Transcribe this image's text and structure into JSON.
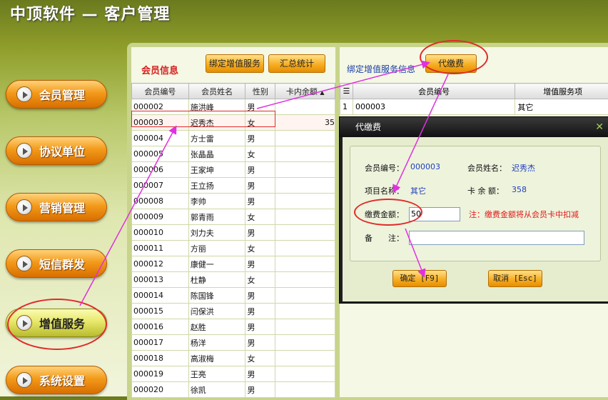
{
  "app": {
    "title": "中顶软件 — 客户管理"
  },
  "nav": [
    {
      "label": "会员管理"
    },
    {
      "label": "协议单位"
    },
    {
      "label": "营销管理"
    },
    {
      "label": "短信群发"
    },
    {
      "label": "增值服务"
    },
    {
      "label": "系统设置"
    }
  ],
  "left": {
    "title": "会员信息",
    "btn_bind": "绑定增值服务",
    "btn_summary": "汇总统计",
    "columns": [
      "会员编号",
      "会员姓名",
      "性别",
      "卡内余额"
    ],
    "rows": [
      [
        "000002",
        "施洪峰",
        "男",
        ""
      ],
      [
        "000003",
        "迟秀杰",
        "女",
        "35"
      ],
      [
        "000004",
        "方士雷",
        "男",
        ""
      ],
      [
        "000005",
        "张晶晶",
        "女",
        ""
      ],
      [
        "000006",
        "王家坤",
        "男",
        ""
      ],
      [
        "000007",
        "王立扬",
        "男",
        ""
      ],
      [
        "000008",
        "李帅",
        "男",
        ""
      ],
      [
        "000009",
        "郭青雨",
        "女",
        ""
      ],
      [
        "000010",
        "刘力夫",
        "男",
        ""
      ],
      [
        "000011",
        "方丽",
        "女",
        ""
      ],
      [
        "000012",
        "康健一",
        "男",
        ""
      ],
      [
        "000013",
        "杜静",
        "女",
        ""
      ],
      [
        "000014",
        "陈国锋",
        "男",
        ""
      ],
      [
        "000015",
        "闫保洪",
        "男",
        ""
      ],
      [
        "000016",
        "赵胜",
        "男",
        ""
      ],
      [
        "000017",
        "杨洋",
        "男",
        ""
      ],
      [
        "000018",
        "高淑梅",
        "女",
        ""
      ],
      [
        "000019",
        "王亮",
        "男",
        ""
      ],
      [
        "000020",
        "徐凯",
        "男",
        ""
      ]
    ]
  },
  "right": {
    "title": "绑定增值服务信息",
    "btn_pay": "代缴费",
    "columns": [
      "会员编号",
      "增值服务项"
    ],
    "rows": [
      [
        "1",
        "000003",
        "其它"
      ]
    ]
  },
  "dialog": {
    "title": "代缴费",
    "member_id_label": "会员编号：",
    "member_id": "000003",
    "member_name_label": "会员姓名：",
    "member_name": "迟秀杰",
    "item_label": "项目名称：",
    "item": "其它",
    "balance_label": "卡 余 额：",
    "balance": "358",
    "amount_label": "缴费金额：",
    "amount": "50",
    "note": "注：缴费金额将从会员卡中扣减",
    "remark_label": "备　　注：",
    "remark": "",
    "ok": "确定 [F9]",
    "cancel": "取消 [Esc]"
  },
  "colors": {
    "annotation_ring": "#e02a2a",
    "annotation_arrow": "#e030e0"
  }
}
